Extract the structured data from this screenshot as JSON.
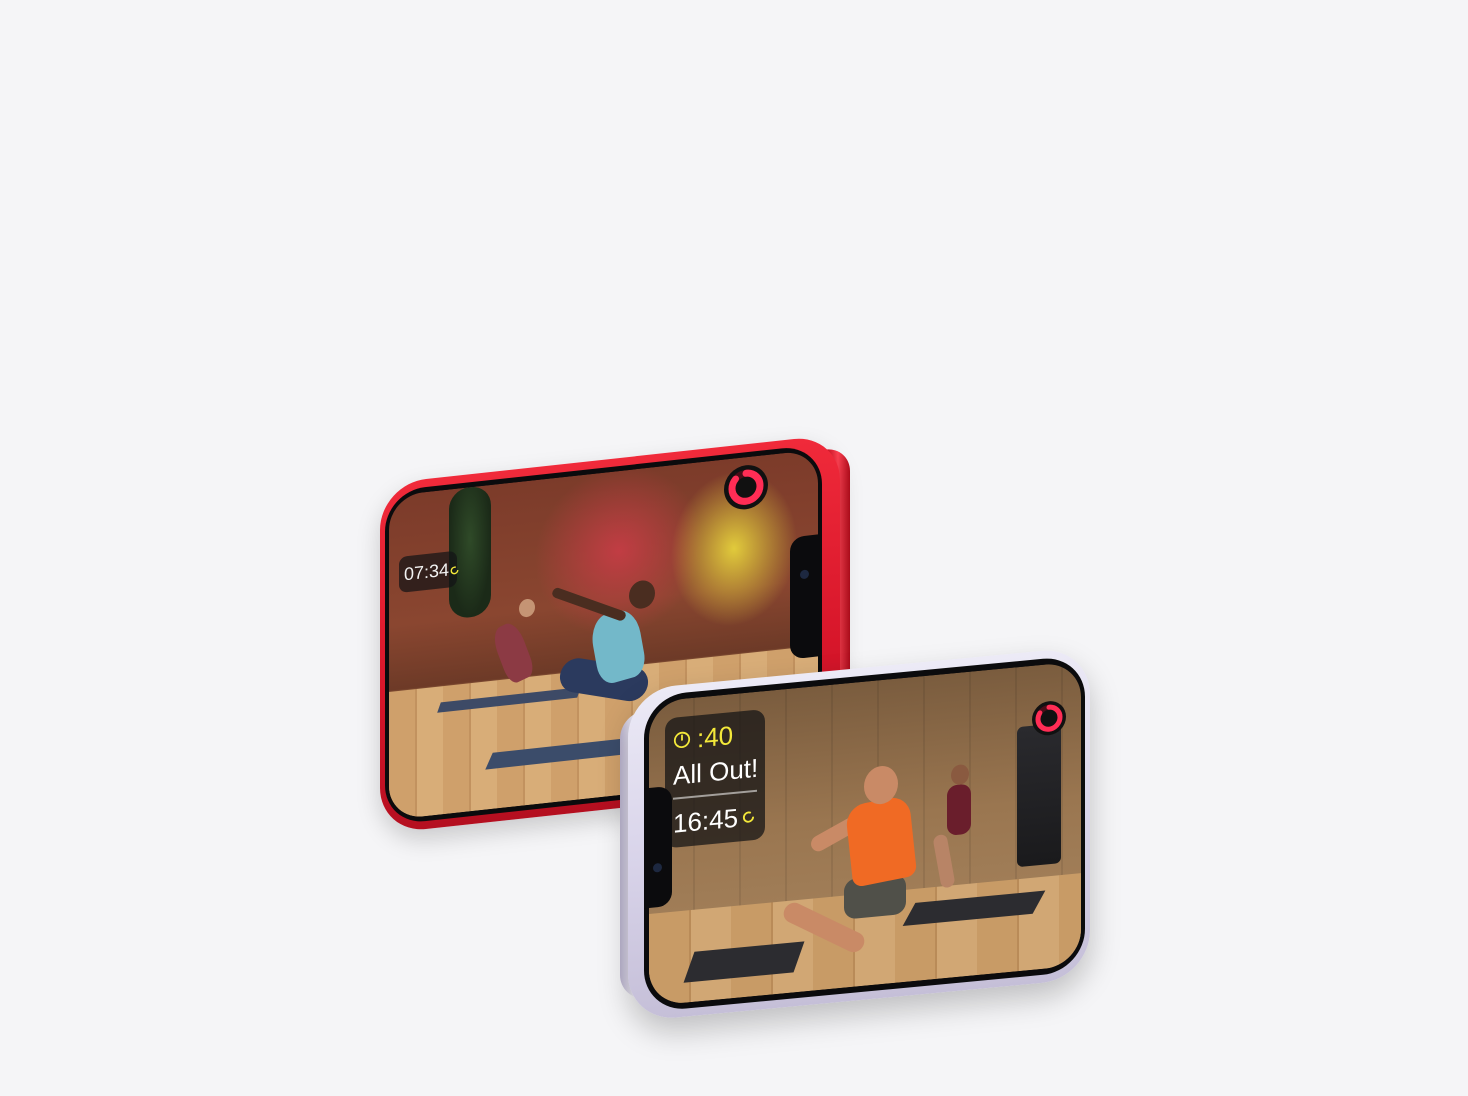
{
  "red_phone": {
    "timer": "07:34",
    "activity_ring_color": "#ff2d55",
    "timer_ring_color": "#f3e83a",
    "frame_color": "#e0192d"
  },
  "purple_phone": {
    "interval_time": ":40",
    "interval_label": "All Out!",
    "elapsed_time": "16:45",
    "accent_yellow": "#f3e83a",
    "activity_ring_color": "#ff2d55",
    "frame_color": "#d9d4ea"
  }
}
